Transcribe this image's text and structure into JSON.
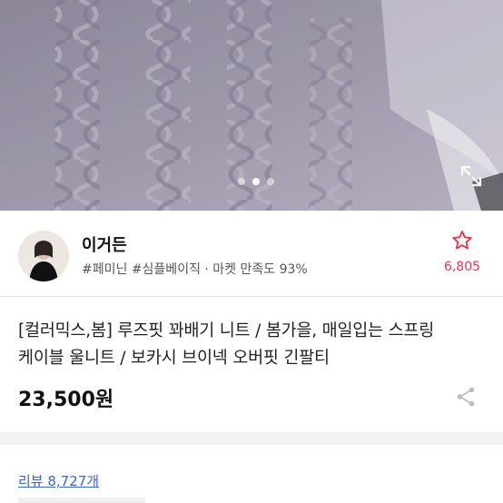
{
  "hero": {
    "expand_icon": "expand-icon",
    "pager_dots": 3,
    "active_dot": 1
  },
  "shop": {
    "name": "이거든",
    "tags": "#페미닌 #심플베이직 · 마켓 만족도 93%",
    "favorite_count": "6,805",
    "favorite_icon": "star-outline-icon"
  },
  "product": {
    "title_line1": "[컬러믹스,봄] 루즈핏 꽈배기 니트 / 봄가을, 매일입는 스프링",
    "title_line2": "케이블 울니트 / 보카시 브이넥 오버핏 긴팔티",
    "price": "23,500원",
    "share_icon": "share-icon"
  },
  "reviews": {
    "label": "리뷰 8,727개"
  },
  "colors": {
    "accent_red": "#e53950",
    "link_blue": "#3a66c4",
    "sweater": "#9c96a8"
  }
}
